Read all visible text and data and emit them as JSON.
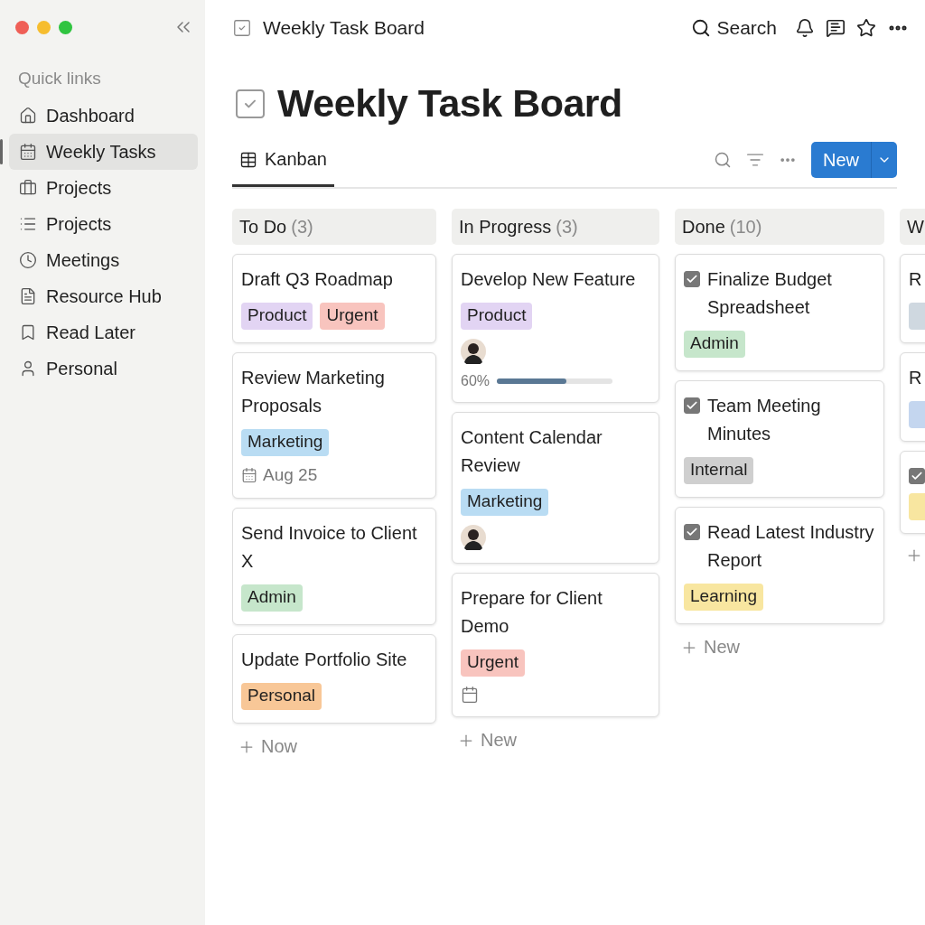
{
  "sidebar": {
    "section_title": "Quick links",
    "items": [
      {
        "label": "Dashboard",
        "selected": false
      },
      {
        "label": "Weekly Tasks",
        "selected": true
      },
      {
        "label": "Projects",
        "selected": false
      },
      {
        "label": "Projects",
        "selected": false
      },
      {
        "label": "Meetings",
        "selected": false
      },
      {
        "label": "Resource Hub",
        "selected": false
      },
      {
        "label": "Read Later",
        "selected": false
      },
      {
        "label": "Personal",
        "selected": false
      }
    ]
  },
  "topbar": {
    "breadcrumb": "Weekly Task Board",
    "search": "Search"
  },
  "page": {
    "title": "Weekly Task Board"
  },
  "views": [
    {
      "label": "Kanban",
      "selected": true
    }
  ],
  "new_button": "New",
  "columns": [
    {
      "title": "To Do",
      "count": "(3)",
      "add_label": "Now",
      "cards": [
        {
          "title": "Draft Q3 Roadmap",
          "tags": [
            {
              "label": "Product",
              "color": "#e2d4f3"
            },
            {
              "label": "Urgent",
              "color": "#f8c4be"
            }
          ]
        },
        {
          "title": "Review Marketing Proposals",
          "tags": [
            {
              "label": "Marketing",
              "color": "#b9dcf3"
            }
          ],
          "date": "Aug 25"
        },
        {
          "title": "Send Invoice to Client X",
          "tags": [
            {
              "label": "Admin",
              "color": "#c6e6cb"
            }
          ]
        },
        {
          "title": "Update Portfolio Site",
          "tags": [
            {
              "label": "Personal",
              "color": "#f8c797"
            }
          ]
        }
      ]
    },
    {
      "title": "In Progress",
      "count": "(3)",
      "add_label": "New",
      "cards": [
        {
          "title": "Develop New Feature",
          "tags": [
            {
              "label": "Product",
              "color": "#e2d4f3"
            }
          ],
          "avatar": true,
          "progress": {
            "level": 0.6,
            "text": "60%"
          }
        },
        {
          "title": "Content Calendar Review",
          "tags": [
            {
              "label": "Marketing",
              "color": "#b9dcf3"
            }
          ],
          "avatar": true
        },
        {
          "title": "Prepare for Client Demo",
          "tags": [
            {
              "label": "Urgent",
              "color": "#f8c4be"
            }
          ],
          "calendar_icon": true
        }
      ]
    },
    {
      "title": "Done",
      "count": "(10)",
      "add_label": "New",
      "cards": [
        {
          "title": "Finalize Budget Spreadsheet",
          "checked": true,
          "tags": [
            {
              "label": "Admin",
              "color": "#c6e6cb"
            }
          ]
        },
        {
          "title": "Team Meeting Minutes",
          "checked": true,
          "tags": [
            {
              "label": "Internal",
              "color": "#cfcfcf"
            }
          ]
        },
        {
          "title": "Read Latest Industry Report",
          "checked": true,
          "tags": [
            {
              "label": "Learning",
              "color": "#f8e6a0"
            }
          ]
        }
      ]
    },
    {
      "title": "W",
      "cards": [
        {
          "title": "R",
          "tags": [
            {
              "color": "#cfd8e0"
            }
          ]
        },
        {
          "title": "R",
          "tags": [
            {
              "color": "#c4d6ef"
            }
          ]
        },
        {
          "checked": true,
          "tags": [
            {
              "color": "#f8e6a0"
            }
          ]
        }
      ]
    }
  ]
}
